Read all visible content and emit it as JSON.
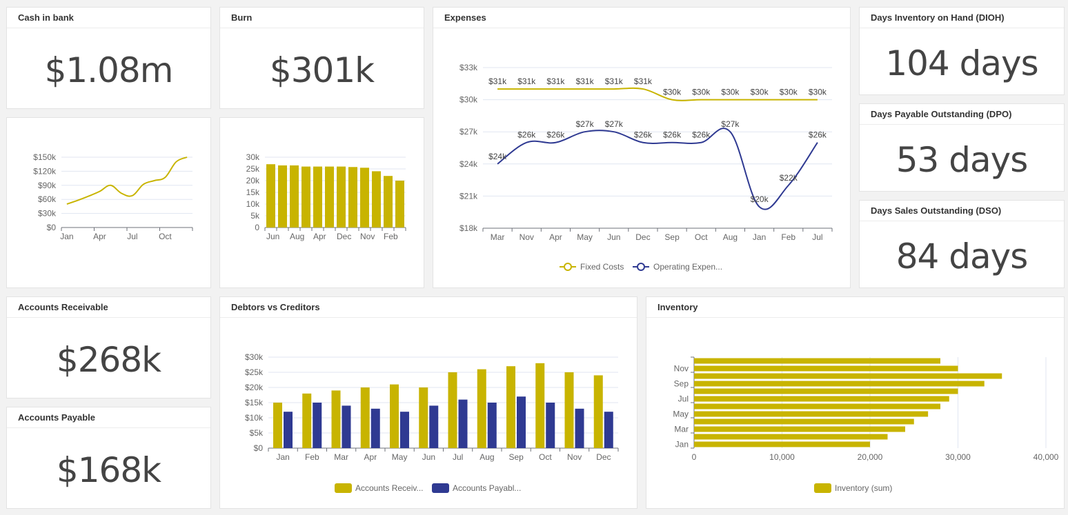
{
  "colors": {
    "gold": "#c8b400",
    "navy": "#2f3a92",
    "grid": "#e0e6f1",
    "axis": "#6e7079"
  },
  "kpis": {
    "cash": {
      "title": "Cash in bank",
      "value": "$1.08m"
    },
    "burn": {
      "title": "Burn",
      "value": "$301k"
    },
    "dioh": {
      "title": "Days Inventory on Hand (DIOH)",
      "value": "104 days"
    },
    "dpo": {
      "title": "Days Payable Outstanding (DPO)",
      "value": "53 days"
    },
    "dso": {
      "title": "Days Sales Outstanding (DSO)",
      "value": "84 days"
    },
    "ar": {
      "title": "Accounts Receivable",
      "value": "$268k"
    },
    "ap": {
      "title": "Accounts Payable",
      "value": "$168k"
    }
  },
  "panels": {
    "expenses": "Expenses",
    "debtors": "Debtors vs Creditors",
    "inventory": "Inventory"
  },
  "chart_data": [
    {
      "id": "cash",
      "type": "line",
      "categories": [
        "Jan",
        "Feb",
        "Mar",
        "Apr",
        "May",
        "Jun",
        "Jul",
        "Aug",
        "Sep",
        "Oct",
        "Nov",
        "Dec"
      ],
      "tick_labels": [
        "Jan",
        "Apr",
        "Jul",
        "Oct"
      ],
      "values": [
        50000,
        58000,
        67000,
        77000,
        90000,
        73000,
        68000,
        92000,
        100000,
        107000,
        140000,
        150000
      ],
      "yticks": [
        "$0",
        "$30k",
        "$60k",
        "$90k",
        "$120k",
        "$150k"
      ],
      "ylim": [
        0,
        150000
      ],
      "grid": true
    },
    {
      "id": "burn",
      "type": "bar",
      "categories": [
        "Jun",
        "",
        "Aug",
        "",
        "Apr",
        "",
        "Dec",
        "",
        "Nov",
        "",
        "Feb",
        ""
      ],
      "values": [
        27000,
        26500,
        26500,
        26000,
        26000,
        26000,
        26000,
        25800,
        25500,
        24000,
        22000,
        20000
      ],
      "yticks": [
        "0",
        "5k",
        "10k",
        "15k",
        "20k",
        "25k",
        "30k"
      ],
      "ylim": [
        0,
        30000
      ],
      "grid": true
    },
    {
      "id": "expenses",
      "type": "line",
      "categories": [
        "Mar",
        "Nov",
        "Apr",
        "May",
        "Jun",
        "Dec",
        "Sep",
        "Oct",
        "Aug",
        "Jan",
        "Feb",
        "Jul"
      ],
      "yticks": [
        "$18k",
        "$21k",
        "$24k",
        "$27k",
        "$30k",
        "$33k"
      ],
      "ylim": [
        18000,
        33000
      ],
      "grid": true,
      "legend": "bottom",
      "series": [
        {
          "name": "Fixed Costs",
          "values": [
            31000,
            31000,
            31000,
            31000,
            31000,
            31000,
            30000,
            30000,
            30000,
            30000,
            30000,
            30000
          ],
          "labels": [
            "$31k",
            "$31k",
            "$31k",
            "$31k",
            "$31k",
            "$31k",
            "$30k",
            "$30k",
            "$30k",
            "$30k",
            "$30k",
            "$30k"
          ]
        },
        {
          "name": "Operating Expen...",
          "values": [
            24000,
            26000,
            26000,
            27000,
            27000,
            26000,
            26000,
            26000,
            27000,
            20000,
            22000,
            26000
          ],
          "labels": [
            "$24k",
            "$26k",
            "$26k",
            "$27k",
            "$27k",
            "$26k",
            "$26k",
            "$26k",
            "$27k",
            "$20k",
            "$22k",
            "$26k"
          ]
        }
      ]
    },
    {
      "id": "debtors",
      "type": "bar",
      "categories": [
        "Jan",
        "Feb",
        "Mar",
        "Apr",
        "May",
        "Jun",
        "Jul",
        "Aug",
        "Sep",
        "Oct",
        "Nov",
        "Dec"
      ],
      "yticks": [
        "$0",
        "$5k",
        "$10k",
        "$15k",
        "$20k",
        "$25k",
        "$30k"
      ],
      "ylim": [
        0,
        30000
      ],
      "grid": true,
      "legend": "bottom",
      "series": [
        {
          "name": "Accounts Receiv...",
          "values": [
            15000,
            18000,
            19000,
            20000,
            21000,
            20000,
            25000,
            26000,
            27000,
            28000,
            25000,
            24000
          ]
        },
        {
          "name": "Accounts Payabl...",
          "values": [
            12000,
            15000,
            14000,
            13000,
            12000,
            14000,
            16000,
            15000,
            17000,
            15000,
            13000,
            12000
          ]
        }
      ]
    },
    {
      "id": "inventory",
      "type": "bar",
      "orientation": "horizontal",
      "categories": [
        "Jan",
        "Feb",
        "Mar",
        "Apr",
        "May",
        "Jun",
        "Jul",
        "Aug",
        "Sep",
        "Oct",
        "Nov",
        "Dec"
      ],
      "tick_labels": [
        "Jan",
        "Mar",
        "May",
        "Jul",
        "Sep",
        "Nov"
      ],
      "values": [
        20000,
        22000,
        24000,
        25000,
        26600,
        28000,
        29000,
        30000,
        33000,
        35000,
        30000,
        28000
      ],
      "xticks": [
        "0",
        "10,000",
        "20,000",
        "30,000",
        "40,000"
      ],
      "xlim": [
        0,
        40000
      ],
      "grid": true,
      "legend": "bottom",
      "series_name": "Inventory (sum)"
    }
  ]
}
